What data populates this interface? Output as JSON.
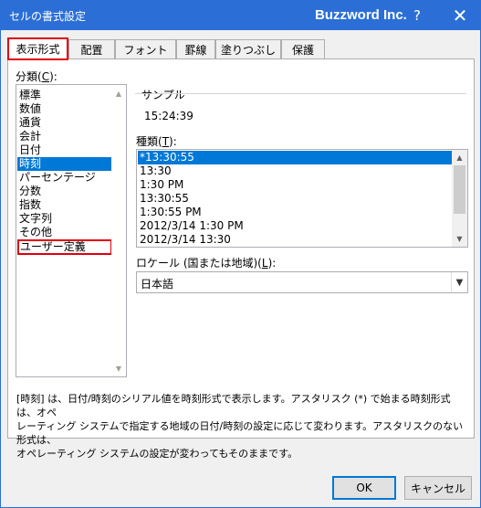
{
  "window": {
    "title": "セルの書式設定",
    "company": "Buzzword Inc.",
    "help_label": "?",
    "close_label": "✕",
    "accent": "#2b6fd6"
  },
  "tabs": [
    {
      "label": "表示形式",
      "active": true
    },
    {
      "label": "配置"
    },
    {
      "label": "フォント"
    },
    {
      "label": "罫線"
    },
    {
      "label": "塗りつぶし"
    },
    {
      "label": "保護"
    }
  ],
  "category": {
    "label_prefix": "分類(",
    "label_key": "C",
    "label_suffix": "):",
    "items": [
      "標準",
      "数値",
      "通貨",
      "会計",
      "日付",
      "時刻",
      "パーセンテージ",
      "分数",
      "指数",
      "文字列",
      "その他",
      "ユーザー定義"
    ],
    "selected": "時刻",
    "highlighted": "ユーザー定義"
  },
  "sample": {
    "label": "サンプル",
    "value": "15:24:39"
  },
  "kind": {
    "label_prefix": "種類(",
    "label_key": "T",
    "label_suffix": "):",
    "items": [
      "*13:30:55",
      "13:30",
      "1:30 PM",
      "13:30:55",
      "1:30:55 PM",
      "2012/3/14 1:30 PM",
      "2012/3/14 13:30"
    ],
    "selected": "*13:30:55"
  },
  "locale": {
    "label_prefix": "ロケール (国または地域)(",
    "label_key": "L",
    "label_suffix": "):",
    "value": "日本語"
  },
  "description": {
    "line1": "[時刻] は、日付/時刻のシリアル値を時刻形式で表示します。アスタリスク (*) で始まる時刻形式は、オペ",
    "line2": "レーティング システムで指定する地域の日付/時刻の設定に応じて変わります。アスタリスクのない形式は、",
    "line3": "オペレーティング システムの設定が変わってもそのままです。"
  },
  "buttons": {
    "ok": "OK",
    "cancel": "キャンセル"
  }
}
